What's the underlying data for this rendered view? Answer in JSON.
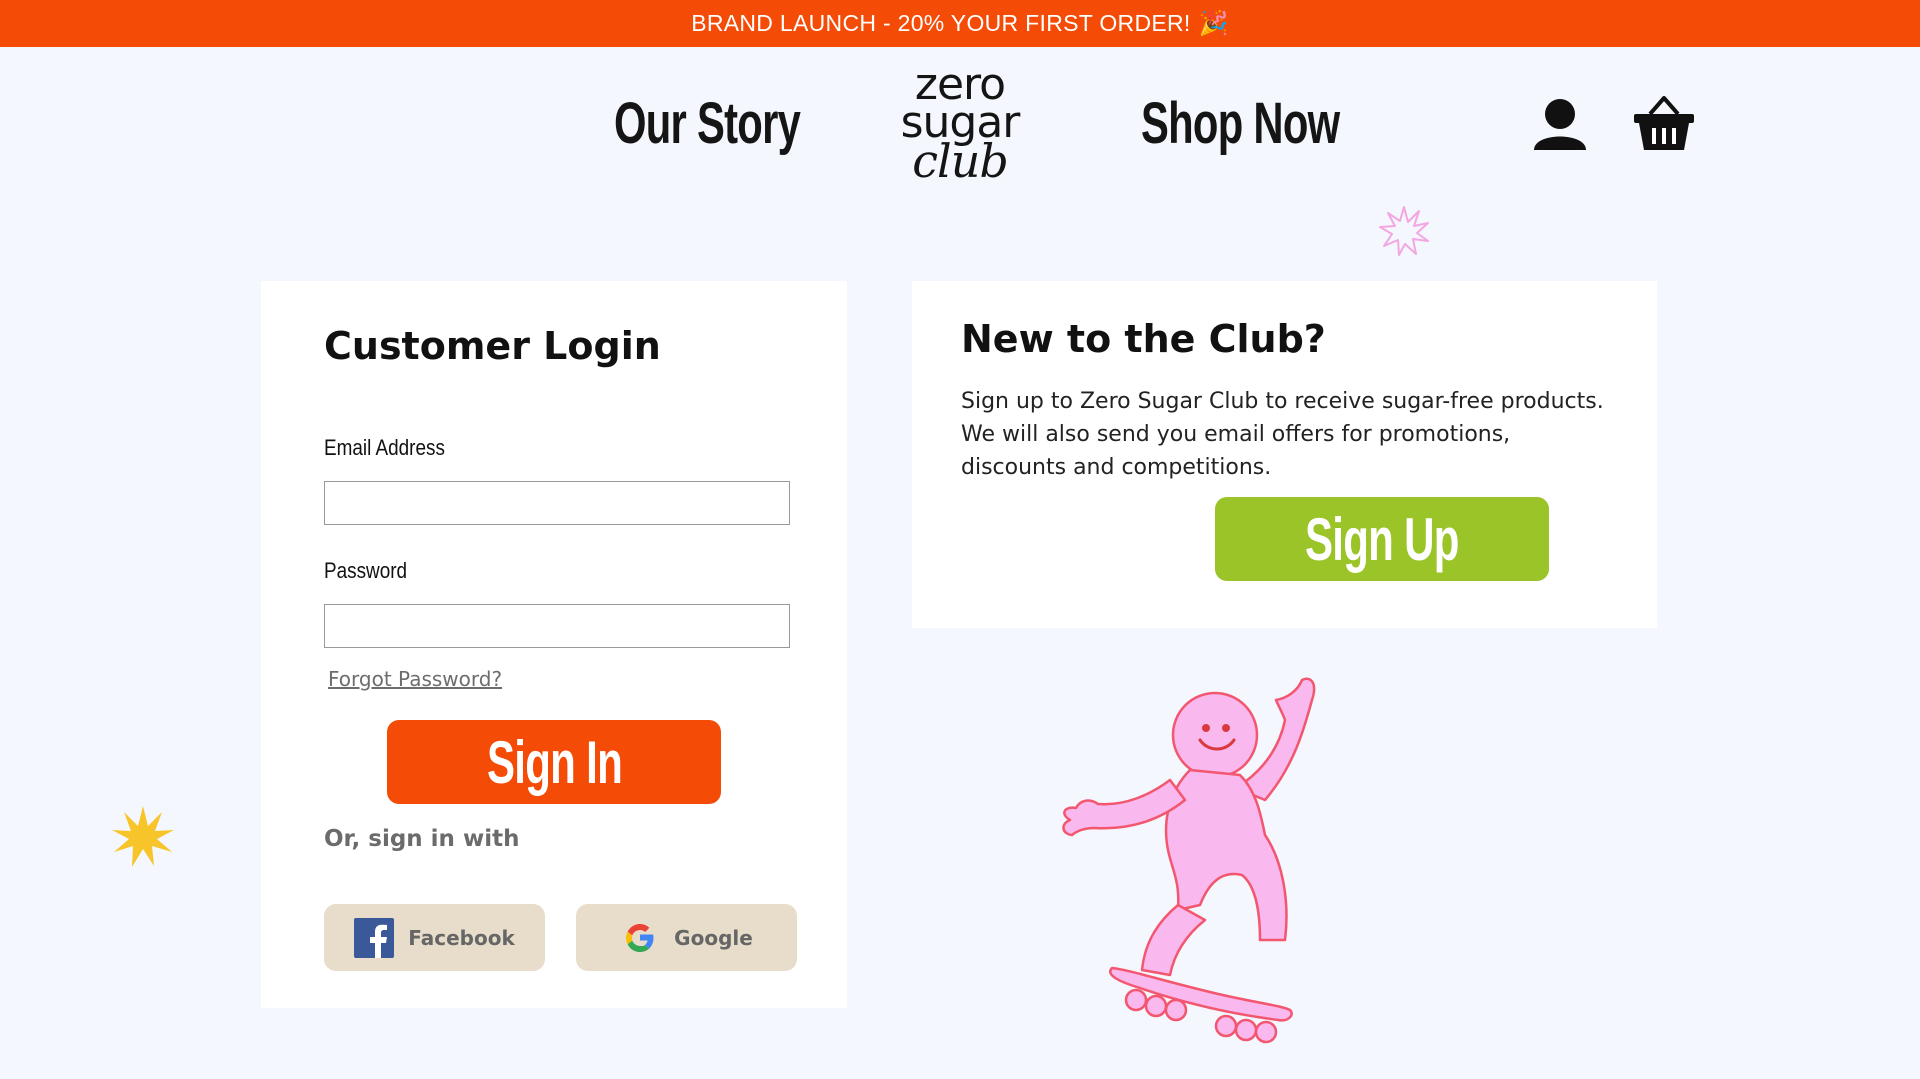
{
  "announcement": {
    "text": "BRAND LAUNCH - 20% YOUR FIRST ORDER!",
    "emoji": "🎉"
  },
  "nav": {
    "our_story": "Our Story",
    "shop_now": "Shop Now",
    "logo": {
      "line1": "zero",
      "line2": "sugar",
      "line3": "club"
    }
  },
  "login": {
    "title": "Customer Login",
    "email_label": "Email Address",
    "email_value": "",
    "password_label": "Password",
    "password_value": "",
    "forgot_link": "Forgot Password?",
    "signin_button": "Sign In",
    "or_text": "Or, sign in with",
    "facebook_label": "Facebook",
    "google_label": "Google"
  },
  "signup": {
    "title": "New to the Club?",
    "description": "Sign up to Zero Sugar Club to receive sugar-free products. We will also send you email offers for promotions, discounts and competitions.",
    "button": "Sign Up"
  },
  "colors": {
    "accent_orange": "#f44b06",
    "accent_green": "#9ac427",
    "social_bg": "#e8ddca",
    "page_bg": "#f4f7fd",
    "mascot_pink": "#f9b8ee",
    "sparkle_yellow": "#f7c52a"
  },
  "icons": [
    "user-icon",
    "cart-icon",
    "facebook-icon",
    "google-icon",
    "sparkle-icon",
    "star-icon"
  ]
}
